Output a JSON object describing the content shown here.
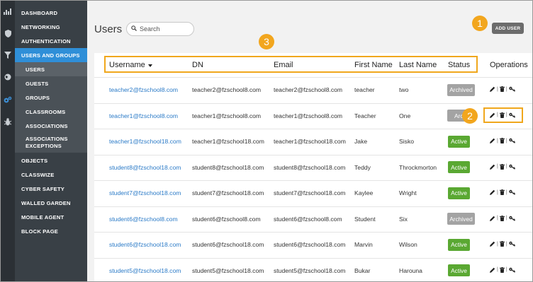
{
  "nav": {
    "items": [
      {
        "label": "DASHBOARD",
        "type": "main"
      },
      {
        "label": "NETWORKING",
        "type": "main"
      },
      {
        "label": "AUTHENTICATION",
        "type": "main"
      },
      {
        "label": "USERS AND GROUPS",
        "type": "active"
      },
      {
        "label": "USERS",
        "type": "subactive"
      },
      {
        "label": "GUESTS",
        "type": "sub"
      },
      {
        "label": "GROUPS",
        "type": "sub"
      },
      {
        "label": "CLASSROOMS",
        "type": "sub"
      },
      {
        "label": "ASSOCIATIONS",
        "type": "sub"
      },
      {
        "label": "ASSOCIATIONS EXCEPTIONS",
        "type": "sub"
      },
      {
        "label": "OBJECTS",
        "type": "main"
      },
      {
        "label": "CLASSWIZE",
        "type": "main"
      },
      {
        "label": "CYBER SAFETY",
        "type": "main"
      },
      {
        "label": "WALLED GARDEN",
        "type": "main"
      },
      {
        "label": "MOBILE AGENT",
        "type": "main"
      },
      {
        "label": "BLOCK PAGE",
        "type": "main"
      }
    ],
    "rail_icons": [
      "chart-icon",
      "shield-icon",
      "filter-icon",
      "globe-icon",
      "gears-icon",
      "bug-icon"
    ]
  },
  "page": {
    "title": "Users",
    "search_placeholder": "Search",
    "add_user": "ADD USER"
  },
  "callouts": [
    "1",
    "2",
    "3"
  ],
  "table": {
    "columns": [
      "Username",
      "DN",
      "Email",
      "First Name",
      "Last Name",
      "Status",
      "Operations"
    ],
    "rows": [
      {
        "username": "teacher2@fzschool8.com",
        "dn": "teacher2@fzschool8.com",
        "email": "teacher2@fzschool8.com",
        "first": "teacher",
        "last": "two",
        "status": "Archived"
      },
      {
        "username": "teacher1@fzschool8.com",
        "dn": "teacher1@fzschool8.com",
        "email": "teacher1@fzschool8.com",
        "first": "Teacher",
        "last": "One",
        "status": "Archi"
      },
      {
        "username": "teacher1@fzschool18.com",
        "dn": "teacher1@fzschool18.com",
        "email": "teacher1@fzschool18.com",
        "first": "Jake",
        "last": "Sisko",
        "status": "Active"
      },
      {
        "username": "student8@fzschool18.com",
        "dn": "student8@fzschool18.com",
        "email": "student8@fzschool18.com",
        "first": "Teddy",
        "last": "Throckmorton",
        "status": "Active"
      },
      {
        "username": "student7@fzschool18.com",
        "dn": "student7@fzschool18.com",
        "email": "student7@fzschool18.com",
        "first": "Kaylee",
        "last": "Wright",
        "status": "Active"
      },
      {
        "username": "student6@fzschool8.com",
        "dn": "student6@fzschool8.com",
        "email": "student6@fzschool8.com",
        "first": "Student",
        "last": "Six",
        "status": "Archived"
      },
      {
        "username": "student6@fzschool18.com",
        "dn": "student6@fzschool18.com",
        "email": "student6@fzschool18.com",
        "first": "Marvin",
        "last": "Wilson",
        "status": "Active"
      },
      {
        "username": "student5@fzschool18.com",
        "dn": "student5@fzschool18.com",
        "email": "student5@fzschool18.com",
        "first": "Bukar",
        "last": "Harouna",
        "status": "Active"
      }
    ]
  },
  "colors": {
    "active": "#5aa832",
    "archived": "#a3a3a3",
    "callout": "#f2a61e",
    "nav_active": "#2f8fd8"
  }
}
